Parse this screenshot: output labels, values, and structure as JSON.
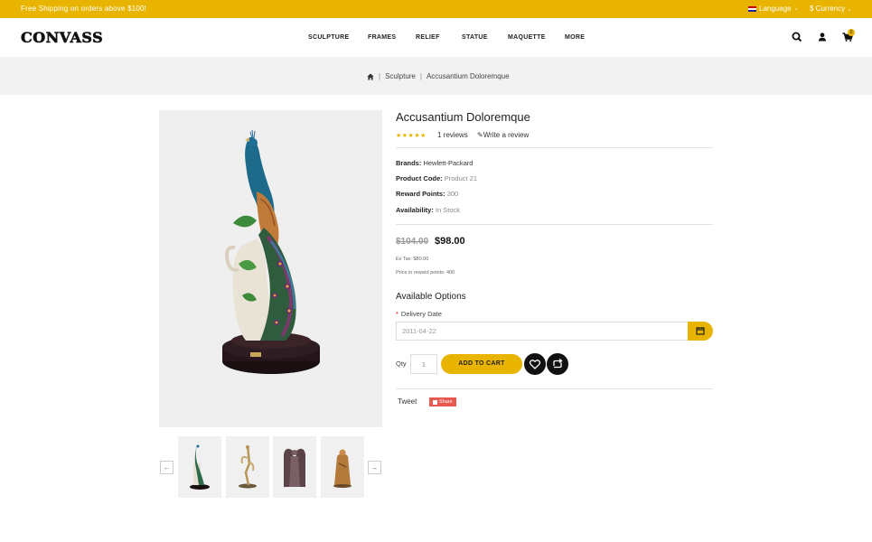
{
  "topbar": {
    "promo": "Free Shipping on orders above $100!",
    "language": "Language",
    "currency": "$ Currency"
  },
  "header": {
    "logo": "CONVASS",
    "nav": [
      "SCULPTURE",
      "FRAMES",
      "RELIEF",
      "STATUE",
      "MAQUETTE",
      "MORE"
    ],
    "cart_count": "0"
  },
  "breadcrumb": {
    "items": [
      "Sculpture",
      "Accusantium Doloremque"
    ]
  },
  "product": {
    "title": "Accusantium Doloremque",
    "stars": "★★★★★",
    "rating": 5,
    "reviews": "1 reviews",
    "write_review": "Write a review",
    "specs": [
      {
        "label": "Brands:",
        "value": "Hewlett-Packard"
      },
      {
        "label": "Product Code:",
        "value": "Product 21"
      },
      {
        "label": "Reward Points:",
        "value": "300"
      },
      {
        "label": "Availability:",
        "value": "In Stock"
      }
    ],
    "old_price": "$104.00",
    "price": "$98.00",
    "ex_tax": "Ex Tax: $80.00",
    "reward_price": "Price in reward points: 400",
    "options_heading": "Available Options",
    "delivery_label": "Delivery Date",
    "required_mark": "*",
    "delivery_date": "2011-04-22",
    "qty_label": "Qty",
    "qty": "1",
    "add_to_cart": "ADD TO CART",
    "tweet": "Tweet",
    "share": "Share"
  },
  "colors": {
    "accent": "#e8b400",
    "dark": "#111111",
    "share": "#e85a4f"
  }
}
